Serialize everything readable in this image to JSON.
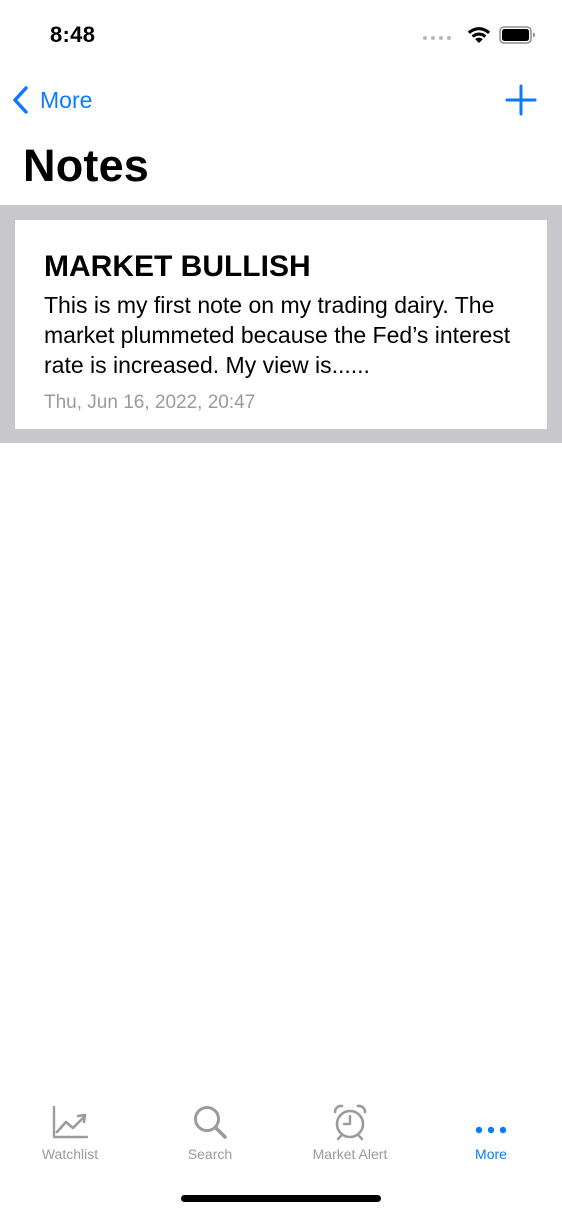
{
  "status_bar": {
    "time": "8:48",
    "signal_icon": "signal-dots-icon",
    "wifi_icon": "wifi-icon",
    "battery_icon": "battery-icon"
  },
  "nav": {
    "back_label": "More",
    "back_icon": "chevron-left-icon",
    "add_icon": "plus-icon",
    "accent_color": "#0a7aff"
  },
  "page": {
    "title": "Notes"
  },
  "notes": [
    {
      "title": "MARKET BULLISH",
      "body": "This is my first note on my trading dairy. The market plummeted because the Fed’s interest rate is increased. My view is......",
      "date": "Thu, Jun 16, 2022, 20:47"
    }
  ],
  "tab_bar": {
    "tabs": [
      {
        "label": "Watchlist",
        "icon": "chart-line-icon",
        "active": false
      },
      {
        "label": "Search",
        "icon": "search-icon",
        "active": false
      },
      {
        "label": "Market Alert",
        "icon": "alarm-clock-icon",
        "active": false
      },
      {
        "label": "More",
        "icon": "more-dots-icon",
        "active": true
      }
    ],
    "active_color": "#0a7aff",
    "inactive_color": "#9a9a9f"
  }
}
